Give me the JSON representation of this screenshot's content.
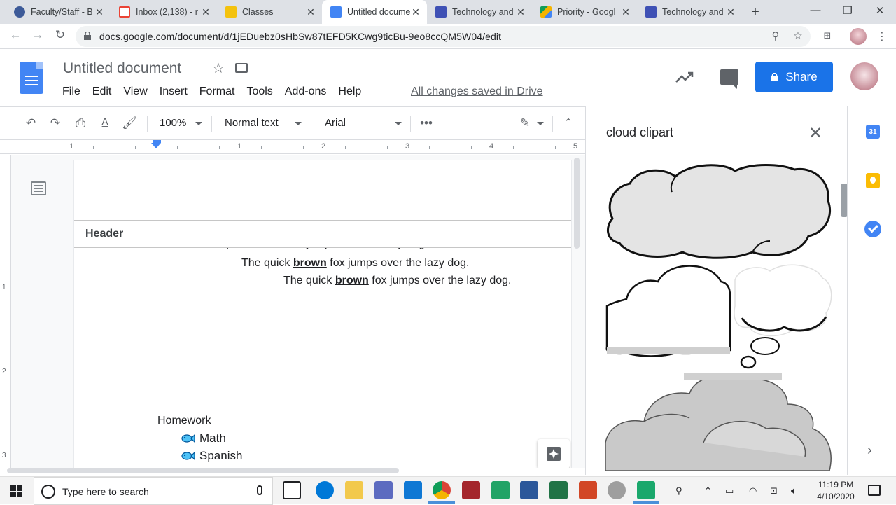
{
  "browser": {
    "tabs": [
      {
        "label": "Faculty/Staff - B",
        "favicon_color": "#3d5a98"
      },
      {
        "label": "Inbox (2,138) - r",
        "favicon_color": "#ea4335"
      },
      {
        "label": "Classes",
        "favicon_color": "#f4c20d"
      },
      {
        "label": "Untitled docume",
        "favicon_color": "#4285f4"
      },
      {
        "label": "Technology and",
        "favicon_color": "#3f51b5"
      },
      {
        "label": "Priority - Googl",
        "favicon_color": "#0f9d58"
      },
      {
        "label": "Technology and",
        "favicon_color": "#3f51b5"
      }
    ],
    "active_tab_index": 3,
    "url": "docs.google.com/document/d/1jEDuebz0sHbSw87tEFD5KCwg9ticBu-9eo8ccQM5W04/edit"
  },
  "docs": {
    "title": "Untitled document",
    "menu": [
      "File",
      "Edit",
      "View",
      "Insert",
      "Format",
      "Tools",
      "Add-ons",
      "Help"
    ],
    "save_status": "All changes saved in Drive",
    "share_label": "Share",
    "toolbar": {
      "zoom": "100%",
      "style": "Normal text",
      "font": "Arial"
    },
    "ruler_numbers": [
      "1",
      "1",
      "2",
      "3",
      "4",
      "5"
    ],
    "vruler_numbers": [
      "1",
      "2",
      "3"
    ]
  },
  "document": {
    "header_label": "Header",
    "lines": [
      {
        "pre": "The quick ",
        "bold": "brown",
        "post": " fox jumps over the lazy dog."
      },
      {
        "pre": "The quick ",
        "bold": "brown",
        "post": " fox jumps over the lazy dog."
      },
      {
        "pre": "The quick ",
        "bold": "brown",
        "post": " fox jumps over the lazy dog."
      }
    ],
    "homework_title": "Homework",
    "homework_items": [
      "Math",
      "Spanish"
    ]
  },
  "explore": {
    "query": "cloud clipart"
  },
  "taskbar": {
    "search_placeholder": "Type here to search",
    "time": "11:19 PM",
    "date": "4/10/2020"
  },
  "colors": {
    "accent": "#1a73e8",
    "docs_blue": "#4285f4"
  }
}
